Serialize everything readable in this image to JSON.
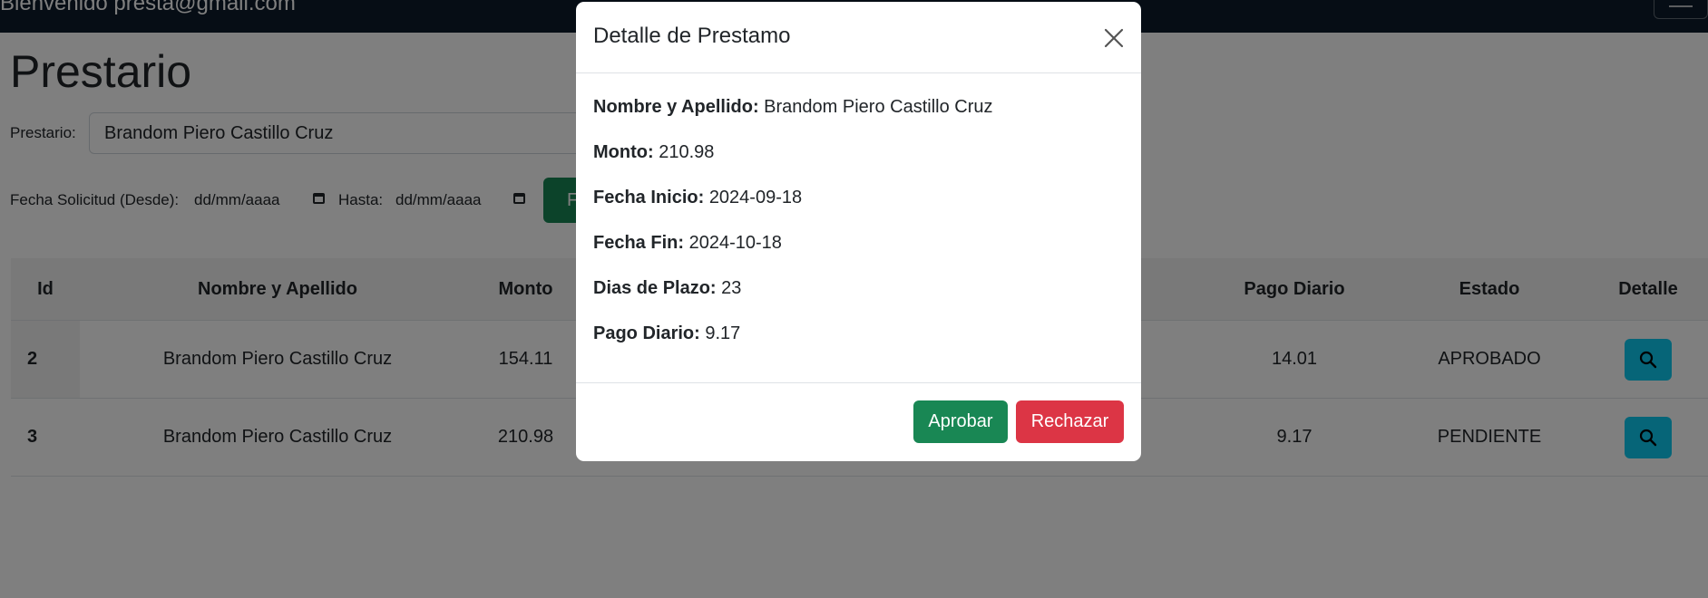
{
  "navbar": {
    "welcome": "Bienvenido presta@gmail.com",
    "menu_icon": "hamburger-icon"
  },
  "page": {
    "title": "Prestario",
    "prestario_label": "Prestario:",
    "prestario_value": "Brandom Piero Castillo Cruz",
    "fecha_desde_label": "Fecha Solicitud (Desde):",
    "fecha_desde_value": "dd/mm/aaaa",
    "hasta_label": "Hasta:",
    "hasta_value": "dd/mm/aaaa",
    "filter_button_label": "F"
  },
  "table": {
    "headers": {
      "id": "Id",
      "nombre": "Nombre y Apellido",
      "monto": "Monto",
      "pago_diario": "Pago Diario",
      "estado": "Estado",
      "detalle": "Detalle"
    },
    "rows": [
      {
        "id": "2",
        "nombre": "Brandom Piero Castillo Cruz",
        "monto": "154.11",
        "pago_diario": "14.01",
        "estado": "APROBADO"
      },
      {
        "id": "3",
        "nombre": "Brandom Piero Castillo Cruz",
        "monto": "210.98",
        "pago_diario": "9.17",
        "estado": "PENDIENTE"
      }
    ],
    "detail_icon": "search-icon"
  },
  "modal": {
    "title": "Detalle de Prestamo",
    "close_icon": "close-icon",
    "fields": [
      {
        "label": "Nombre y Apellido:",
        "value": "Brandom Piero Castillo Cruz"
      },
      {
        "label": "Monto:",
        "value": "210.98"
      },
      {
        "label": "Fecha Inicio:",
        "value": "2024-09-18"
      },
      {
        "label": "Fecha Fin:",
        "value": "2024-10-18"
      },
      {
        "label": "Dias de Plazo:",
        "value": "23"
      },
      {
        "label": "Pago Diario:",
        "value": "9.17"
      }
    ],
    "aprobar_label": "Aprobar",
    "rechazar_label": "Rechazar"
  },
  "colors": {
    "navbar": "#0d1b2a",
    "success": "#198754",
    "danger": "#dc3545",
    "info": "#0dcaf0"
  }
}
